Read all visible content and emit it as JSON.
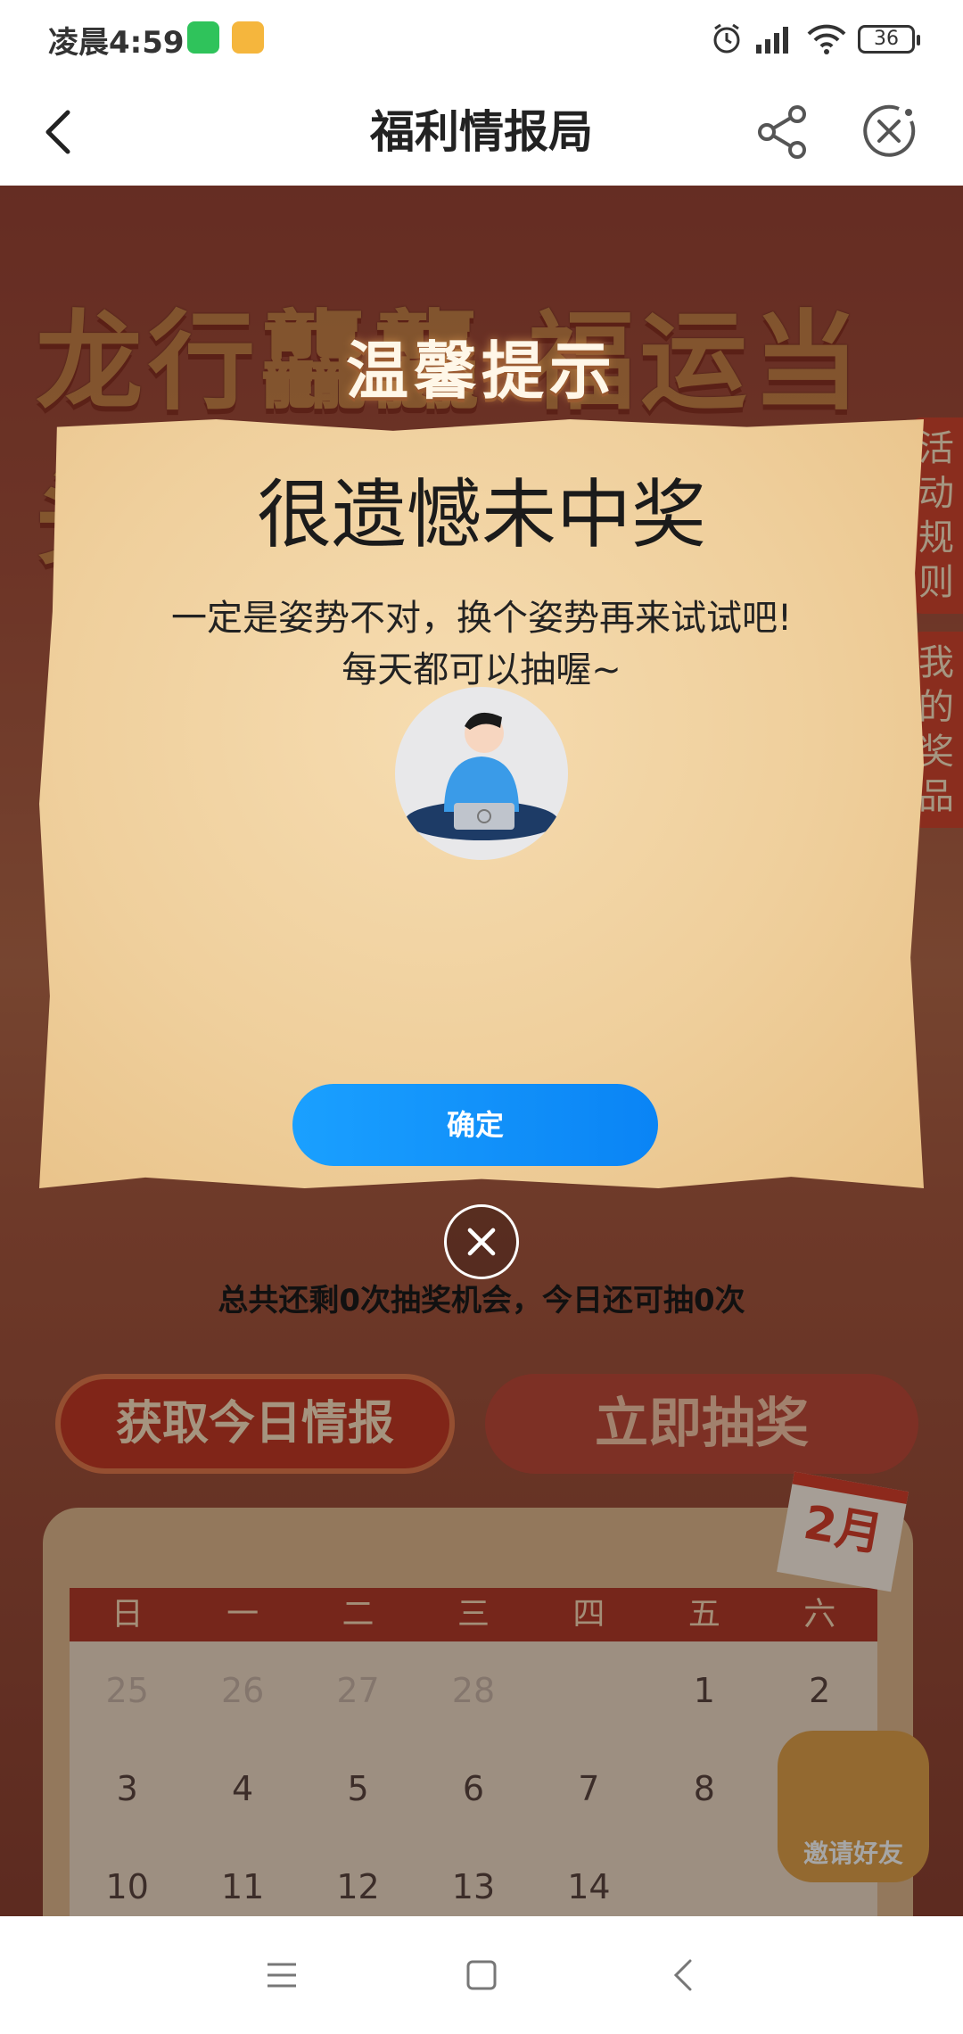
{
  "status_bar": {
    "time": "凌晨4:59",
    "battery": "36"
  },
  "nav": {
    "title": "福利情报局"
  },
  "background": {
    "banner": "龙行龘龘  福运当头",
    "side_rules": "活动规则",
    "side_prizes": "我的奖品",
    "btn_today": "获取今日情报",
    "btn_draw": "立即抽奖",
    "month": "2月",
    "invite": "邀请好友",
    "weekdays": [
      "日",
      "一",
      "二",
      "三",
      "四",
      "五",
      "六"
    ],
    "week1": [
      "25",
      "26",
      "27",
      "28",
      "",
      "1",
      "2"
    ],
    "week2": [
      "3",
      "4",
      "5",
      "6",
      "7",
      "8",
      ""
    ],
    "week3": [
      "10",
      "11",
      "12",
      "13",
      "14",
      "",
      ""
    ]
  },
  "dialog": {
    "heading": "温馨提示",
    "title": "很遗憾未中奖",
    "message_line1": "一定是姿势不对，换个姿势再来试试吧!",
    "message_line2": "每天都可以抽喔~",
    "confirm_label": "确定"
  },
  "remaining": "总共还剩0次抽奖机会，今日还可抽0次",
  "colors": {
    "accent_blue": "#0a84f5",
    "festival_red": "#c53a26"
  }
}
